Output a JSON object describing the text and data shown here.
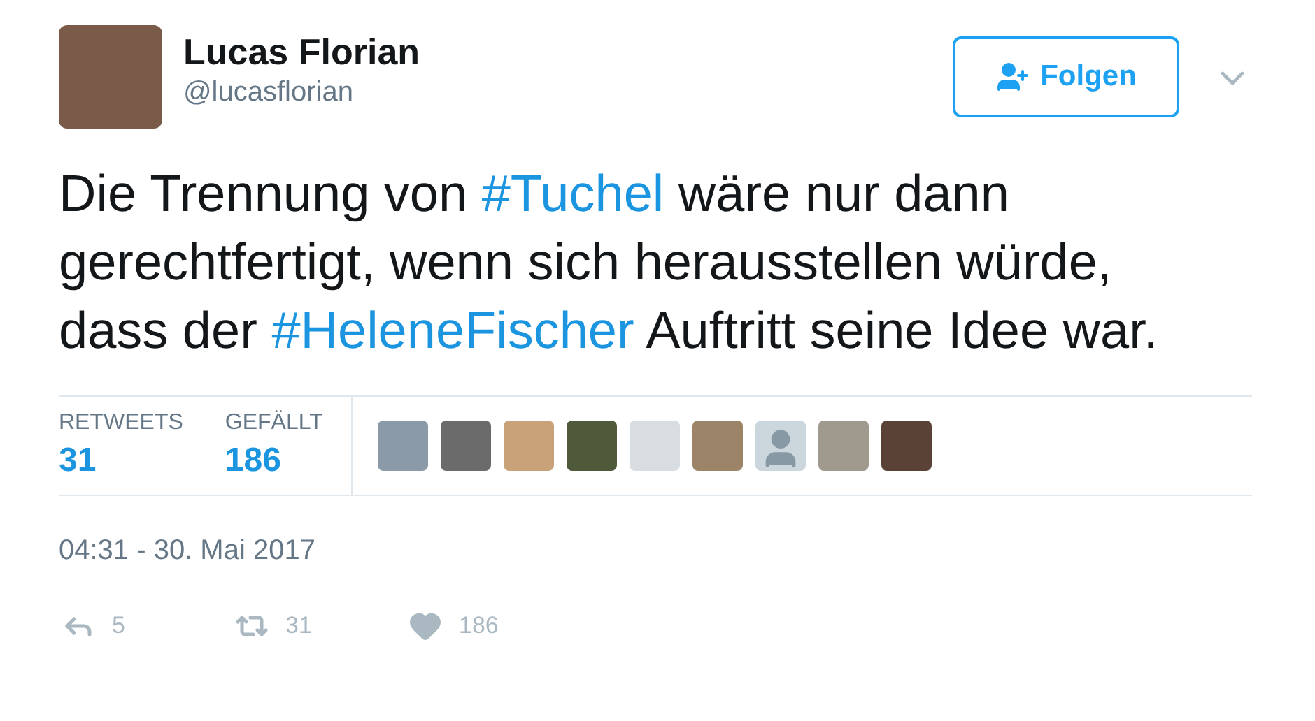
{
  "author": {
    "name": "Lucas Florian",
    "handle": "@lucasflorian"
  },
  "follow_button": {
    "label": "Folgen"
  },
  "tweet_text": [
    {
      "kind": "plain",
      "text": "Die Trennung von "
    },
    {
      "kind": "hashtag",
      "text": "#Tuchel"
    },
    {
      "kind": "plain",
      "text": " wäre nur dann gerechtfertigt, wenn sich herausstellen würde, dass der "
    },
    {
      "kind": "hashtag",
      "text": "#HeleneFischer"
    },
    {
      "kind": "plain",
      "text": " Auftritt seine Idee war."
    }
  ],
  "stats": [
    {
      "label": "RETWEETS",
      "value": "31"
    },
    {
      "label": "GEFÄLLT",
      "value": "186"
    }
  ],
  "liker_avatars": [
    {
      "kind": "photo"
    },
    {
      "kind": "photo"
    },
    {
      "kind": "photo"
    },
    {
      "kind": "photo"
    },
    {
      "kind": "photo"
    },
    {
      "kind": "photo"
    },
    {
      "kind": "default"
    },
    {
      "kind": "photo"
    },
    {
      "kind": "photo"
    }
  ],
  "timestamp": "04:31 - 30. Mai 2017",
  "actions": [
    {
      "kind": "reply",
      "count": "5"
    },
    {
      "kind": "retweet",
      "count": "31"
    },
    {
      "kind": "like",
      "count": "186"
    }
  ]
}
